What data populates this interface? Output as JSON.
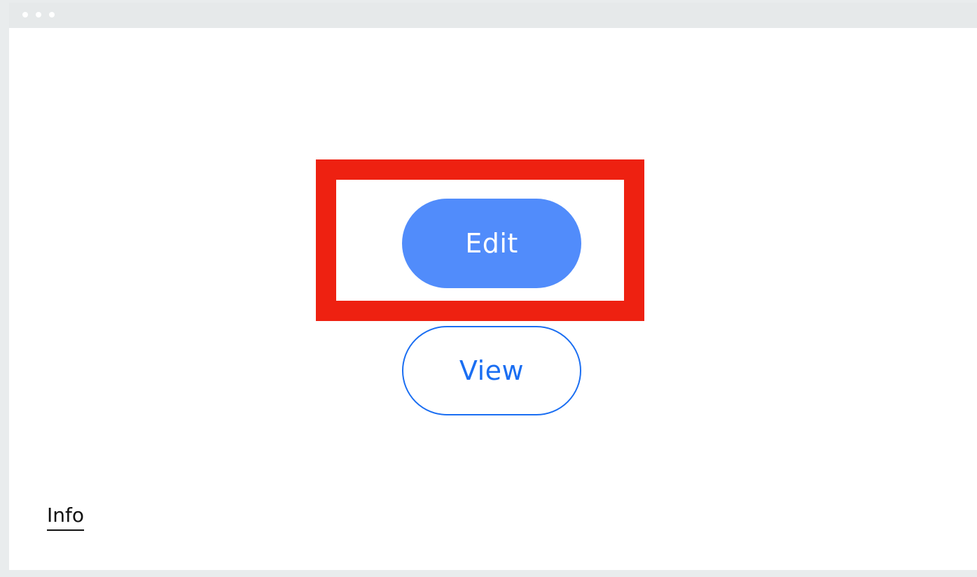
{
  "window": {
    "titlebar_dots": [
      "dot",
      "dot",
      "dot"
    ]
  },
  "main": {
    "edit_label": "Edit",
    "view_label": "View",
    "info_label": "Info"
  },
  "colors": {
    "highlight": "#ee2111",
    "edit_bg": "#518cfb",
    "view_accent": "#1a6ef2"
  }
}
